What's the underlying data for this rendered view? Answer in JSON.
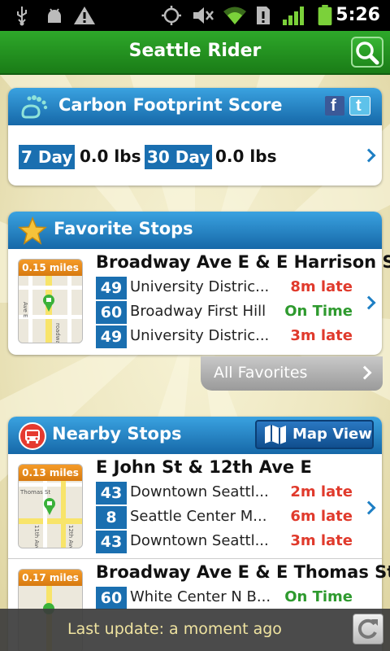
{
  "statusbar": {
    "time": "5:26"
  },
  "app": {
    "title": "Seattle Rider"
  },
  "carbon": {
    "title": "Carbon Footprint Score",
    "periods": [
      {
        "label": "7 Day",
        "value": "0.0 lbs"
      },
      {
        "label": "30 Day",
        "value": "0.0 lbs"
      }
    ]
  },
  "favorites": {
    "title": "Favorite Stops",
    "stops": [
      {
        "distance": "0.15 miles",
        "name": "Broadway Ave E & E Harrison St",
        "routes": [
          {
            "num": "49",
            "dest": "University Distric...",
            "status": "8m late",
            "kind": "late"
          },
          {
            "num": "60",
            "dest": "Broadway First Hill",
            "status": "On Time",
            "kind": "ontime"
          },
          {
            "num": "49",
            "dest": "University Distric...",
            "status": "3m late",
            "kind": "late"
          }
        ]
      }
    ],
    "all_label": "All Favorites"
  },
  "nearby": {
    "title": "Nearby Stops",
    "map_view_label": "Map View",
    "stops": [
      {
        "distance": "0.13 miles",
        "name": "E John St & 12th Ave E",
        "routes": [
          {
            "num": "43",
            "dest": "Downtown Seattl...",
            "status": "2m late",
            "kind": "late"
          },
          {
            "num": "8",
            "dest": "Seattle Center M...",
            "status": "6m late",
            "kind": "late"
          },
          {
            "num": "43",
            "dest": "Downtown Seattl...",
            "status": "3m late",
            "kind": "late"
          }
        ]
      },
      {
        "distance": "0.17 miles",
        "name": "Broadway Ave E & E Thomas St",
        "routes": [
          {
            "num": "60",
            "dest": "White Center N B...",
            "status": "On Time",
            "kind": "ontime"
          }
        ]
      }
    ]
  },
  "footer": {
    "last_update": "Last update: a moment ago"
  },
  "map_labels": {
    "fav": [
      "Ave E",
      "roadway"
    ],
    "nearby1": [
      "Thomas St",
      "11th Ave",
      "12th Ave"
    ]
  },
  "icons": {
    "facebook": "facebook-icon",
    "twitter": "twitter-icon",
    "footprint": "footprint-icon",
    "star": "star-icon",
    "bus": "bus-icon",
    "map": "map-icon",
    "search": "search-icon",
    "refresh": "refresh-icon"
  },
  "colors": {
    "titlebar": "#1f8f1c",
    "header_blue": "#1e7fc4",
    "late": "#e03a2c",
    "ontime": "#2e9a2e",
    "route_badge": "#1a6fb0"
  }
}
